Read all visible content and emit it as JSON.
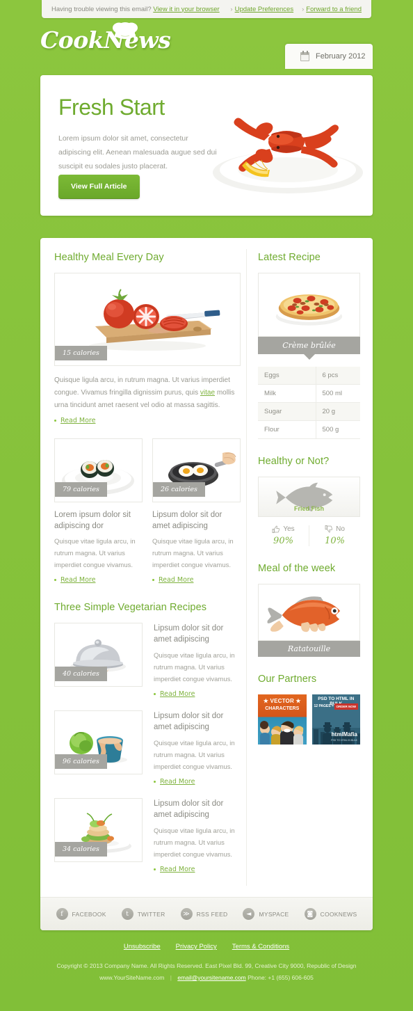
{
  "preheader": {
    "trouble_text": "Having trouble viewing this email?",
    "browser_link": "View it in your browser",
    "update_prefs": "Update Preferences",
    "forward": "Forward to a friend",
    "caret": "›"
  },
  "header": {
    "logo": "CookNews",
    "date": "February 2012",
    "calendar_icon": "calendar-icon"
  },
  "hero": {
    "title": "Fresh Start",
    "description": "Lorem ipsum dolor sit amet, consectetur adipiscing elit. Aenean malesuada augue sed dui suscipit eu sodales justo placerat.",
    "button": "View Full Article",
    "image": "lobster-on-plate-illustration"
  },
  "main": {
    "featured": {
      "heading": "Healthy Meal Every Day",
      "image": "tomatoes-on-cutting-board-illustration",
      "calories": "15 calories",
      "body_before": "Quisque ligula arcu, in rutrum magna. Ut varius imperdiet congue. Vivamus fringilla dignissim purus, quis ",
      "body_mark": "vitae",
      "body_after": " mollis urna tincidunt amet raesent vel odio at massa sagittis.",
      "read_more": "Read More"
    },
    "sub_articles": [
      {
        "image": "sushi-on-plate-illustration",
        "calories": "79 calories",
        "title": "Lorem ipsum dolor sit adipiscing dor",
        "body": "Quisque vitae ligula arcu, in rutrum magna. Ut varius imperdiet congue vivamus.",
        "read_more": "Read More"
      },
      {
        "image": "fried-eggs-in-pan-illustration",
        "calories": "26 calories",
        "title": "Lipsum dolor sit dor amet adipiscing",
        "body": "Quisque vitae ligula arcu, in rutrum magna. Ut varius imperdiet congue vivamus.",
        "read_more": "Read More"
      }
    ],
    "vegetarian": {
      "heading": "Three Simple Vegetarian Recipes",
      "items": [
        {
          "image": "cloche-serving-dome-illustration",
          "calories": "40 calories",
          "title": "Lipsum dolor sit dor amet adipiscing",
          "body": "Quisque vitae ligula arcu, in rutrum magna. Ut varius imperdiet congue vivamus.",
          "read_more": "Read More"
        },
        {
          "image": "cabbage-and-bowl-illustration",
          "calories": "96 calories",
          "title": "Lipsum dolor sit dor amet adipiscing",
          "body": "Quisque vitae ligula arcu, in rutrum magna. Ut varius imperdiet congue vivamus.",
          "read_more": "Read More"
        },
        {
          "image": "plated-gourmet-stack-illustration",
          "calories": "34 calories",
          "title": "Lipsum dolor sit dor amet adipiscing",
          "body": "Quisque vitae ligula arcu, in rutrum magna. Ut varius imperdiet congue vivamus.",
          "read_more": "Read More"
        }
      ]
    }
  },
  "sidebar": {
    "latest_recipe": {
      "heading": "Latest Recipe",
      "image": "pizza-illustration",
      "caption": "Crème brûlée",
      "ingredients": [
        {
          "name": "Eggs",
          "qty": "6 pcs"
        },
        {
          "name": "Milk",
          "qty": "500 ml"
        },
        {
          "name": "Sugar",
          "qty": "20 g"
        },
        {
          "name": "Flour",
          "qty": "500 g"
        }
      ]
    },
    "healthy_or_not": {
      "heading": "Healthy or Not?",
      "image": "fish-silhouette-illustration",
      "subject": "Fried Fish",
      "yes_label": "Yes",
      "yes_pct": "90%",
      "no_label": "No",
      "no_pct": "10%"
    },
    "meal_of_week": {
      "heading": "Meal of the week",
      "image": "hand-holding-orange-fish-illustration",
      "caption": "Ratatouille"
    },
    "partners": {
      "heading": "Our Partners",
      "ads": [
        {
          "name": "vector-characters-ad",
          "line1": "★ VECTOR ★",
          "line2": "CHARACTERS"
        },
        {
          "name": "htmlmafia-ad",
          "line1": "PSD TO HTML IN BULK",
          "line2": "12 PAGES = $480",
          "cta": "ORDER NOW",
          "brand": "htmlMafia",
          "tagline": "PSD TO HTML IN BULK"
        }
      ]
    }
  },
  "social": [
    {
      "icon": "facebook-icon",
      "glyph": "f",
      "label": "FACEBOOK"
    },
    {
      "icon": "twitter-icon",
      "glyph": "t",
      "label": "TWITTER"
    },
    {
      "icon": "rss-icon",
      "glyph": "≫",
      "label": "RSS FEED"
    },
    {
      "icon": "myspace-icon",
      "glyph": "◄",
      "label": "MYSPACE"
    },
    {
      "icon": "cooknews-icon",
      "glyph": "◙",
      "label": "COOKNEWS"
    }
  ],
  "footer": {
    "links": [
      "Unsubscribe",
      "Privacy Policy",
      "Terms & Conditions"
    ],
    "copyright": "Copyright © 2013 Company Name. All Rights Reserved. East Pixel Bld. 99, Creative City 9000, Republic of Design",
    "website": "www.YourSiteName.com",
    "email": "email@yoursitename.com",
    "phone": "Phone: +1 (655) 606-605"
  },
  "colors": {
    "brand_green": "#8cc63e",
    "heading_green": "#6fab2f",
    "link_green": "#7eb23d",
    "badge_gray": "#a5a5a0",
    "card_white": "#ffffff"
  }
}
